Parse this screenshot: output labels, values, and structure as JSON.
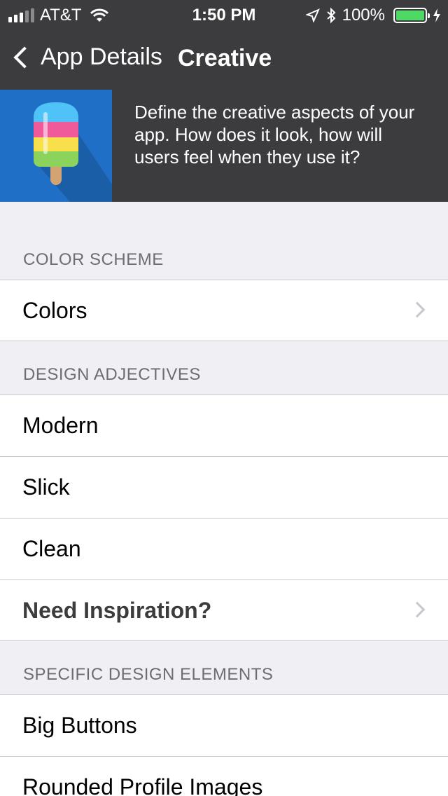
{
  "status_bar": {
    "carrier": "AT&T",
    "time": "1:50 PM",
    "battery": "100%",
    "battery_level": 1.0,
    "battery_color": "#4cd964"
  },
  "nav": {
    "back_label": "App Details",
    "title": "Creative",
    "background": "#3c3c3e"
  },
  "banner": {
    "text": "Define the creative aspects of your app. How does it look, how will users feel when they use it?",
    "image_icon": "popsicle-icon"
  },
  "sections": [
    {
      "header": "COLOR SCHEME",
      "rows": [
        {
          "label": "Colors",
          "chevron": true
        }
      ]
    },
    {
      "header": "DESIGN ADJECTIVES",
      "rows": [
        {
          "label": "Modern"
        },
        {
          "label": "Slick"
        },
        {
          "label": "Clean"
        },
        {
          "label": "Need Inspiration?",
          "chevron": true
        }
      ]
    },
    {
      "header": "SPECIFIC DESIGN ELEMENTS",
      "rows": [
        {
          "label": "Big Buttons"
        },
        {
          "label": "Rounded Profile Images"
        }
      ]
    }
  ]
}
